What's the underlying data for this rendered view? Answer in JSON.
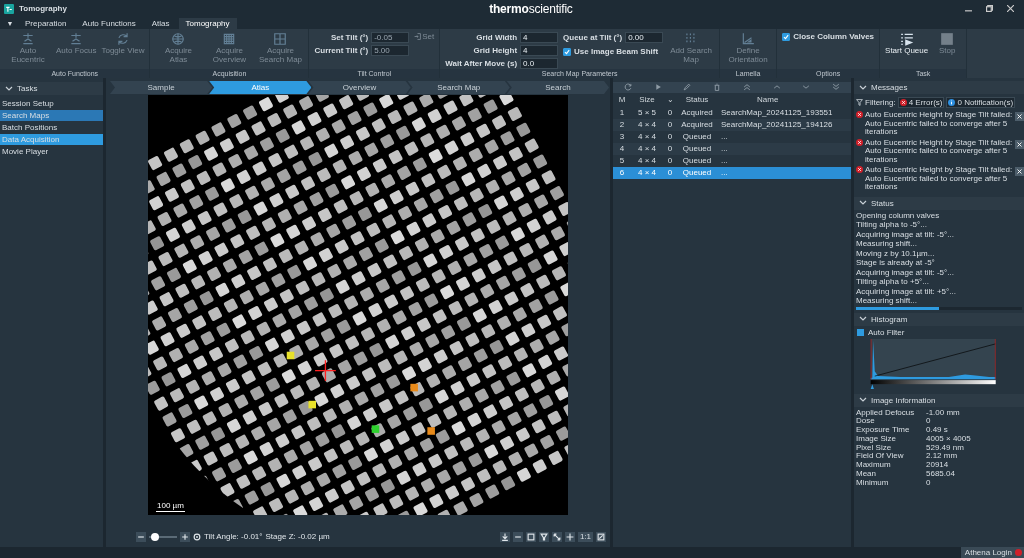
{
  "window": {
    "title": "Tomography",
    "logo": "**thermo**scientific"
  },
  "ribbon": {
    "menu": "▼",
    "tabs": [
      {
        "label": "Preparation",
        "selected": false
      },
      {
        "label": "Auto Functions",
        "selected": false
      },
      {
        "label": "Atlas",
        "selected": false
      },
      {
        "label": "Tomography",
        "selected": true
      }
    ],
    "groups": [
      {
        "label": "Auto Functions",
        "columns": [
          [
            {
              "kind": "button",
              "label": "Auto Eucentric",
              "disabled": true
            }
          ],
          [
            {
              "kind": "button",
              "label": "Auto Focus",
              "disabled": true
            }
          ],
          [
            {
              "kind": "button",
              "label": "Toggle View",
              "disabled": true
            }
          ]
        ]
      },
      {
        "label": "Acquisition",
        "columns": [
          [
            {
              "kind": "button",
              "label": "Acquire Atlas",
              "disabled": true
            }
          ],
          [
            {
              "kind": "button",
              "label": "Acquire Overview",
              "disabled": true
            }
          ],
          [
            {
              "kind": "button",
              "label": "Acquire Search Map",
              "disabled": true
            }
          ]
        ]
      },
      {
        "label": "Tilt Control",
        "columns": [
          [
            {
              "kind": "field",
              "label": "Set Tilt (°)",
              "value": "-0.05",
              "disabled": true
            },
            {
              "kind": "field",
              "label": "Current Tilt (°)",
              "value": "5.00",
              "disabled": true
            }
          ],
          [
            {
              "kind": "small_button",
              "label": "Set",
              "disabled": true
            }
          ]
        ]
      },
      {
        "label": "Search Map Parameters",
        "columns": [
          [
            {
              "kind": "field",
              "label": "Grid Width",
              "value": "4",
              "disabled": false
            },
            {
              "kind": "field",
              "label": "Grid Height",
              "value": "4",
              "disabled": false
            },
            {
              "kind": "field",
              "label": "Wait After Move (s)",
              "value": "0.0",
              "disabled": false
            }
          ],
          [
            {
              "kind": "field",
              "label": "Queue at Tilt (°)",
              "value": "0.00",
              "disabled": false
            },
            {
              "kind": "checkbox",
              "label": "Use Image Beam Shift",
              "checked": true
            }
          ],
          [
            {
              "kind": "button",
              "label": "Add Search Map",
              "disabled": true
            }
          ]
        ]
      },
      {
        "label": "Lamella",
        "columns": [
          [
            {
              "kind": "button",
              "label": "Define Orientation",
              "disabled": true
            }
          ]
        ]
      },
      {
        "label": "Options",
        "columns": [
          [
            {
              "kind": "checkbox",
              "label": "Close Column Valves",
              "checked": true
            }
          ]
        ]
      },
      {
        "label": "Task",
        "columns": [
          [
            {
              "kind": "button",
              "label": "Start Queue",
              "disabled": false
            }
          ],
          [
            {
              "kind": "button",
              "label": "Stop",
              "disabled": true
            }
          ]
        ]
      }
    ]
  },
  "tasks": {
    "title": "Tasks",
    "items": [
      {
        "label": "Session Setup",
        "selected": false,
        "focused": false
      },
      {
        "label": "Search Maps",
        "selected": true,
        "focused": false
      },
      {
        "label": "Batch Positions",
        "selected": false,
        "focused": false
      },
      {
        "label": "Data Acquisition",
        "selected": true,
        "focused": true
      },
      {
        "label": "Movie Player",
        "selected": false,
        "focused": false
      }
    ]
  },
  "workflow_steps": [
    {
      "label": "Sample",
      "selected": false
    },
    {
      "label": "Atlas",
      "selected": true
    },
    {
      "label": "Overview",
      "selected": false
    },
    {
      "label": "Search Map",
      "selected": false
    },
    {
      "label": "Search",
      "selected": false
    }
  ],
  "viewer": {
    "scale_bar": "100 µm",
    "zoom_slider": {
      "level": 0.2
    },
    "tilt_angle": "Tilt Angle: -0.01°",
    "stage_z": "Stage Z: -0.02 µm",
    "actual_size": "1:1"
  },
  "map_table": {
    "columns": [
      "M",
      "Size",
      "⌄",
      "Status",
      "Name"
    ],
    "rows": [
      {
        "cells": [
          "1",
          "5 × 5",
          "0",
          "Acquired",
          "SearchMap_20241125_193551"
        ],
        "selected": false
      },
      {
        "cells": [
          "2",
          "4 × 4",
          "0",
          "Acquired",
          "SearchMap_20241125_194126"
        ],
        "selected": false
      },
      {
        "cells": [
          "3",
          "4 × 4",
          "0",
          "Queued",
          "..."
        ],
        "selected": false
      },
      {
        "cells": [
          "4",
          "4 × 4",
          "0",
          "Queued",
          "..."
        ],
        "selected": false
      },
      {
        "cells": [
          "5",
          "4 × 4",
          "0",
          "Queued",
          "..."
        ],
        "selected": false
      },
      {
        "cells": [
          "6",
          "4 × 4",
          "0",
          "Queued",
          "..."
        ],
        "selected": true
      }
    ]
  },
  "messages": {
    "title": "Messages",
    "filter_label": "Filtering:",
    "errors_filter": "4 Error(s)",
    "notifications_filter": "0 Notification(s)",
    "items": [
      "Auto Eucentric Height by Stage Tilt failed: Auto Eucentric failed to converge after 5 iterations",
      "Auto Eucentric Height by Stage Tilt failed: Auto Eucentric failed to converge after 5 iterations",
      "Auto Eucentric Height by Stage Tilt failed: Auto Eucentric failed to converge after 5 iterations"
    ]
  },
  "status": {
    "title": "Status",
    "lines": [
      "Opening column valves",
      "Tilting alpha to -5°...",
      "Acquiring image at tilt: -5°...",
      "Measuring shift...",
      "Moving z by 10.1µm...",
      "Stage is already at -5°",
      "Acquiring image at tilt: -5°...",
      "Tilting alpha to +5°...",
      "Acquiring image at tilt: +5°...",
      "Measuring shift..."
    ],
    "level": 0.5
  },
  "histogram": {
    "title": "Histogram",
    "auto_filter": {
      "label": "Auto Filter",
      "checked": true
    }
  },
  "image_information": {
    "title": "Image Information",
    "rows": [
      {
        "label": "Applied Defocus",
        "value": "-1.00 mm"
      },
      {
        "label": "Dose",
        "value": "0"
      },
      {
        "label": "Exposure Time",
        "value": "0.49 s"
      },
      {
        "label": "Image Size",
        "value": "4005 × 4005"
      },
      {
        "label": "Pixel Size",
        "value": "529.49 nm"
      },
      {
        "label": "Field Of View",
        "value": "2.12 mm"
      },
      {
        "label": "Maximum",
        "value": "20914"
      },
      {
        "label": "Mean",
        "value": "5685.04"
      },
      {
        "label": "Minimum",
        "value": "0"
      }
    ]
  },
  "status_bar": {
    "login": "Athena Login"
  }
}
